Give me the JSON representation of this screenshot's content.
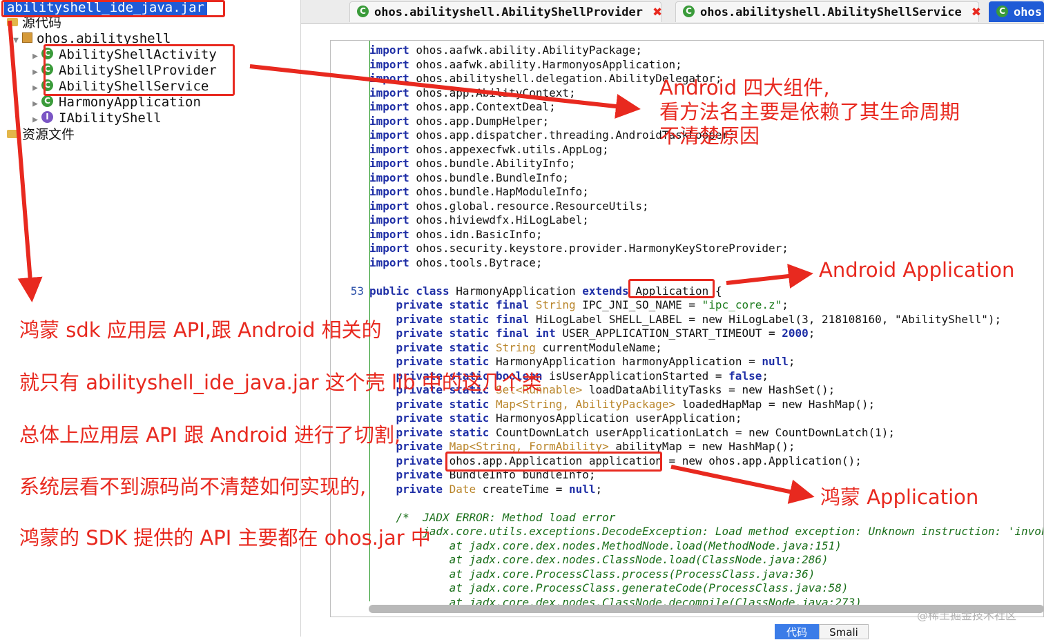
{
  "tree": {
    "jar": "abilityshell_ide_java.jar",
    "source_folder": "源代码",
    "package": "ohos.abilityshell",
    "classes": [
      {
        "name": "AbilityShellActivity",
        "kind": "class"
      },
      {
        "name": "AbilityShellProvider",
        "kind": "class"
      },
      {
        "name": "AbilityShellService",
        "kind": "class"
      },
      {
        "name": "HarmonyApplication",
        "kind": "class"
      },
      {
        "name": "IAbilityShell",
        "kind": "interface"
      }
    ],
    "resources": "资源文件"
  },
  "tabs": [
    {
      "label": "ohos.abilityshell.AbilityShellProvider"
    },
    {
      "label": "ohos.abilityshell.AbilityShellService"
    },
    {
      "label": "ohos"
    }
  ],
  "code": {
    "imports": [
      "ohos.aafwk.ability.AbilityPackage;",
      "ohos.aafwk.ability.HarmonyosApplication;",
      "ohos.abilityshell.delegation.AbilityDelegator;",
      "ohos.app.AbilityContext;",
      "ohos.app.ContextDeal;",
      "ohos.app.DumpHelper;",
      "ohos.app.dispatcher.threading.AndroidTaskLooper;",
      "ohos.appexecfwk.utils.AppLog;",
      "ohos.bundle.AbilityInfo;",
      "ohos.bundle.BundleInfo;",
      "ohos.bundle.HapModuleInfo;",
      "ohos.global.resource.ResourceUtils;",
      "ohos.hiviewdfx.HiLogLabel;",
      "ohos.idn.BasicInfo;",
      "ohos.security.keystore.provider.HarmonyKeyStoreProvider;",
      "ohos.tools.Bytrace;"
    ],
    "import_kw": "import",
    "class_line_no": "53",
    "class_decl": {
      "kw1": "public class",
      "name": "HarmonyApplication",
      "kw2": "extends",
      "base": "Application",
      "tail": " {"
    },
    "fields": [
      {
        "mods": "private static final",
        "type": "String",
        "rest": " IPC_JNI_SO_NAME = ",
        "val": "\"ipc_core.z\"",
        "end": ";"
      },
      {
        "mods": "private static final",
        "type": "HiLogLabel",
        "rest": " SHELL_LABEL = ",
        "val": "new HiLogLabel(3, 218108160, \"AbilityShell\")",
        "end": ";"
      },
      {
        "mods": "private static final",
        "type": "int",
        "rest": " USER_APPLICATION_START_TIMEOUT = ",
        "val": "2000",
        "end": ";"
      },
      {
        "mods": "private static",
        "type": "String",
        "rest": " currentModuleName",
        "val": "",
        "end": ";"
      },
      {
        "mods": "private static",
        "type": "HarmonyApplication",
        "rest": " harmonyApplication = ",
        "val": "null",
        "end": ";"
      },
      {
        "mods": "private static",
        "type": "boolean",
        "rest": " isUserApplicationStarted = ",
        "val": "false",
        "end": ";"
      },
      {
        "mods": "private static",
        "type": "Set<Runnable>",
        "rest": " loadDataAbilityTasks = ",
        "val": "new HashSet()",
        "end": ";"
      },
      {
        "mods": "private static",
        "type": "Map<String, AbilityPackage>",
        "rest": " loadedHapMap = ",
        "val": "new HashMap()",
        "end": ";"
      },
      {
        "mods": "private static",
        "type": "HarmonyosApplication",
        "rest": " userApplication",
        "val": "",
        "end": ";"
      },
      {
        "mods": "private static",
        "type": "CountDownLatch",
        "rest": " userApplicationLatch = ",
        "val": "new CountDownLatch(1)",
        "end": ";"
      },
      {
        "mods": "private",
        "type": "Map<String, FormAbility>",
        "rest": " abilityMap = ",
        "val": "new HashMap()",
        "end": ";"
      },
      {
        "mods": "private",
        "type": "ohos.app.Application",
        "rest": " application = ",
        "val": "new ohos.app.Application()",
        "end": ";"
      },
      {
        "mods": "private",
        "type": "BundleInfo",
        "rest": " bundleInfo",
        "val": "",
        "end": ";"
      },
      {
        "mods": "private",
        "type": "Date",
        "rest": " createTime = ",
        "val": "null",
        "end": ";"
      }
    ],
    "error_lines": [
      "/*  JADX ERROR: Method load error",
      "    jadx.core.utils.exceptions.DecodeException: Load method exception: Unknown instruction: 'invoke",
      "        at jadx.core.dex.nodes.MethodNode.load(MethodNode.java:151)",
      "        at jadx.core.dex.nodes.ClassNode.load(ClassNode.java:286)",
      "        at jadx.core.ProcessClass.process(ProcessClass.java:36)",
      "        at jadx.core.ProcessClass.generateCode(ProcessClass.java:58)",
      "        at jadx.core.dex.nodes.ClassNode.decompile(ClassNode.java:273)"
    ]
  },
  "bottom_tabs": [
    "代码",
    "Smali"
  ],
  "watermark": "@稀土掘金技术社区",
  "annotations": {
    "four_components": [
      "Android 四大组件,",
      "看方法名主要是依赖了其生命周期",
      "不清楚原因"
    ],
    "android_app": "Android Application",
    "harmony_app": "鸿蒙 Application",
    "summary": [
      "鸿蒙 sdk 应用层 API,跟 Android 相关的",
      "就只有 abilityshell_ide_java.jar 这个壳 lib 中的这几个类",
      "总体上应用层 API 跟 Android 进行了切割,",
      "系统层看不到源码尚不清楚如何实现的,",
      "鸿蒙的 SDK 提供的 API 主要都在 ohos.jar 中"
    ]
  },
  "colors": {
    "accent_red": "#e8291f",
    "selection_blue": "#1f5bd6",
    "keyword_blue": "#1f2fa6"
  }
}
